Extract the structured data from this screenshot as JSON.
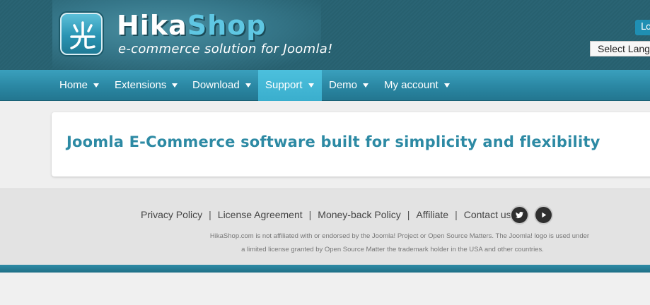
{
  "header": {
    "brand_part1": "Hika",
    "brand_part2": "Shop",
    "tagline": "e-commerce solution for Joomla!",
    "login_label": "Lo",
    "language_select": "Select Language"
  },
  "nav": {
    "items": [
      {
        "label": "Home",
        "active": false
      },
      {
        "label": "Extensions",
        "active": false
      },
      {
        "label": "Download",
        "active": false
      },
      {
        "label": "Support",
        "active": true
      },
      {
        "label": "Demo",
        "active": false
      },
      {
        "label": "My account",
        "active": false
      }
    ]
  },
  "main": {
    "heading": "Joomla E-Commerce software built for simplicity and flexibility"
  },
  "footer": {
    "links": [
      "Privacy Policy",
      "License Agreement",
      "Money-back Policy",
      "Affiliate",
      "Contact us"
    ],
    "separator": "|",
    "social": [
      "twitter-icon",
      "youtube-icon"
    ],
    "disclaimer_line1": "HikaShop.com is not affiliated with or endorsed by the Joomla! Project or Open Source Matters. The Joomla! logo is used under",
    "disclaimer_line2": "a limited license granted by Open Source Matter the trademark holder in the USA and other countries."
  },
  "colors": {
    "header_bg": "#2a6474",
    "nav_bg": "#2a87a3",
    "nav_active": "#3aaecd",
    "heading": "#2d8aa4",
    "brand_accent": "#5fc7e3"
  }
}
